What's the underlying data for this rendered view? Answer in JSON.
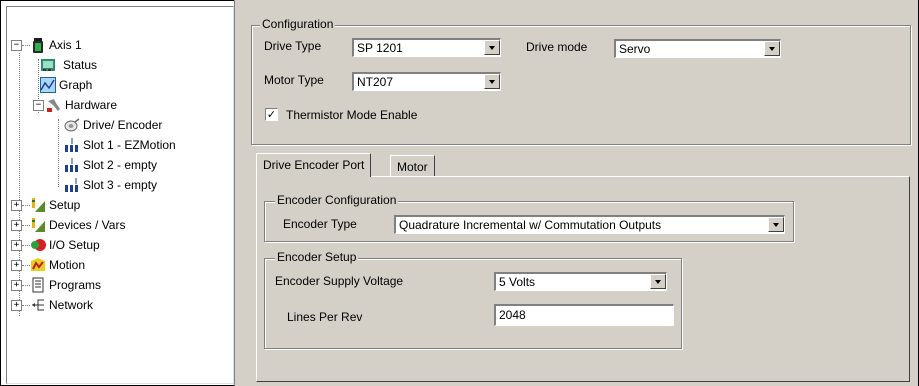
{
  "tree": {
    "root": {
      "label": "Axis 1",
      "expander": "−"
    },
    "items": [
      {
        "label": "Status",
        "icon": "status-icon"
      },
      {
        "label": "Graph",
        "icon": "graph-icon"
      },
      {
        "label": "Hardware",
        "icon": "hardware-icon",
        "expander": "−"
      },
      {
        "label": "Drive/ Encoder",
        "icon": "drive-encoder-icon"
      },
      {
        "label": "Slot 1 - EZMotion",
        "icon": "slot-icon"
      },
      {
        "label": "Slot 2 - empty",
        "icon": "slot-icon"
      },
      {
        "label": "Slot 3 - empty",
        "icon": "slot-icon"
      },
      {
        "label": "Setup",
        "icon": "setup-icon",
        "expander": "+"
      },
      {
        "label": "Devices / Vars",
        "icon": "devices-icon",
        "expander": "+"
      },
      {
        "label": "I/O Setup",
        "icon": "io-setup-icon",
        "expander": "+"
      },
      {
        "label": "Motion",
        "icon": "motion-icon",
        "expander": "+"
      },
      {
        "label": "Programs",
        "icon": "programs-icon",
        "expander": "+"
      },
      {
        "label": "Network",
        "icon": "network-icon",
        "expander": "+"
      }
    ]
  },
  "configuration": {
    "title": "Configuration",
    "drive_type_label": "Drive Type",
    "drive_type_value": "SP 1201",
    "drive_mode_label": "Drive mode",
    "drive_mode_value": "Servo",
    "motor_type_label": "Motor Type",
    "motor_type_value": "NT207",
    "thermistor_label": "Thermistor Mode Enable",
    "thermistor_checked": "✓"
  },
  "tabs": [
    {
      "label": "Drive Encoder Port",
      "active": true
    },
    {
      "label": "Motor",
      "active": false
    }
  ],
  "encoder_configuration": {
    "title": "Encoder Configuration",
    "encoder_type_label": "Encoder Type",
    "encoder_type_value": "Quadrature Incremental w/ Commutation Outputs"
  },
  "encoder_setup": {
    "title": "Encoder Setup",
    "supply_voltage_label": "Encoder Supply Voltage",
    "supply_voltage_value": "5 Volts",
    "lines_per_rev_label": "Lines Per Rev",
    "lines_per_rev_value": "2048"
  }
}
